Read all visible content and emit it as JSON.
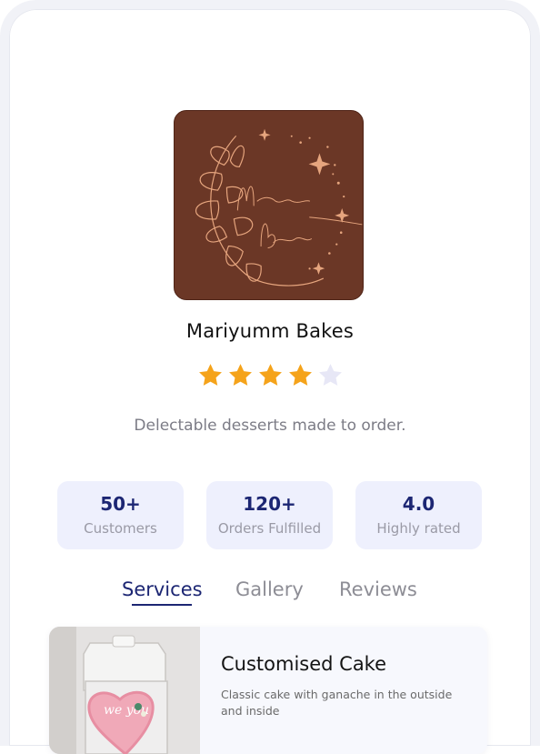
{
  "shop": {
    "name": "Mariyumm Bakes",
    "logo_text_line1": "Mariyumm",
    "logo_text_line2": "Bakes",
    "tagline": "Delectable desserts made to order.",
    "rating": 4,
    "rating_max": 5
  },
  "stats": [
    {
      "value": "50+",
      "label": "Customers"
    },
    {
      "value": "120+",
      "label": "Orders Fulfilled"
    },
    {
      "value": "4.0",
      "label": "Highly rated"
    }
  ],
  "tabs": [
    {
      "label": "Services",
      "active": true
    },
    {
      "label": "Gallery",
      "active": false
    },
    {
      "label": "Reviews",
      "active": false
    }
  ],
  "services": [
    {
      "title": "Customised Cake",
      "description": "Classic cake with ganache in the outside and inside",
      "image_caption": "we you"
    }
  ],
  "colors": {
    "accent": "#1c2673",
    "star_filled": "#f5a31a",
    "star_empty": "#e7e7f6",
    "stat_bg": "#eef0fd",
    "logo_bg": "#6b3726",
    "logo_gold": "#e6a57e"
  }
}
